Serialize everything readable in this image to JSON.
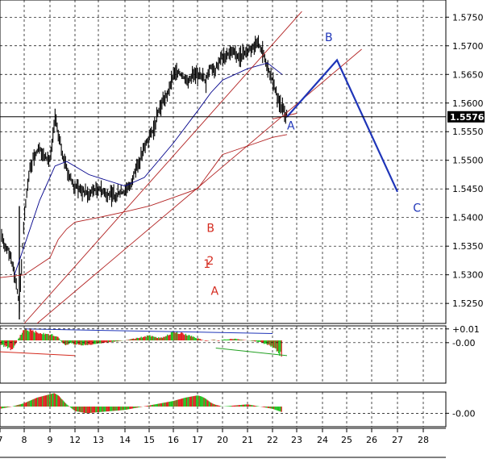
{
  "chart_data": [
    {
      "type": "line",
      "panel": "price",
      "series_kind": "bar-ohlc",
      "title": "",
      "xlabel": "",
      "ylabel": "",
      "xlim": [
        7,
        28.8
      ],
      "ylim": [
        1.5215,
        1.578
      ],
      "x_ticks": [
        "7",
        "8",
        "9",
        "12",
        "13",
        "14",
        "15",
        "16",
        "17",
        "20",
        "21",
        "22",
        "23",
        "24",
        "25",
        "26",
        "27",
        "28"
      ],
      "y_ticks": [
        "1.5750",
        "1.5700",
        "1.5650",
        "1.5600",
        "1.5550",
        "1.5500",
        "1.5450",
        "1.5400",
        "1.5350",
        "1.5300",
        "1.5250"
      ],
      "grid": true,
      "current_price": "1.5576",
      "price_series": {
        "x": [
          7.0,
          7.4,
          7.6,
          7.8,
          8.0,
          8.2,
          8.4,
          8.6,
          8.8,
          9.0,
          9.2,
          9.4,
          9.6,
          9.8,
          10.0,
          10.2,
          10.4,
          10.6,
          10.8,
          11.0,
          11.2,
          11.4,
          11.6,
          11.8,
          12.0,
          12.2,
          12.4,
          12.6,
          12.8,
          13.0,
          13.2,
          13.4,
          13.6,
          13.8,
          14.0,
          14.2,
          14.4,
          14.6,
          14.8,
          15.0,
          15.2,
          15.4,
          15.6,
          15.8,
          16.0,
          16.2,
          16.4,
          16.6,
          16.8,
          17.0,
          17.2,
          17.4,
          17.6,
          17.8,
          18.0,
          18.2,
          18.4,
          18.6,
          18.8,
          19.0,
          19.2,
          19.4,
          19.6,
          19.8,
          20.0,
          20.2,
          20.4,
          20.6,
          20.8,
          21.0,
          21.2,
          21.4,
          21.6,
          21.8,
          22.0,
          22.2,
          22.4,
          22.6
        ],
        "values": [
          1.5365,
          1.534,
          1.53,
          1.525,
          1.54,
          1.548,
          1.551,
          1.552,
          1.5505,
          1.55,
          1.552,
          1.5545,
          1.558,
          1.556,
          1.5545,
          1.553,
          1.552,
          1.5505,
          1.5495,
          1.5485,
          1.5478,
          1.547,
          1.5462,
          1.5458,
          1.5455,
          1.545,
          1.5445,
          1.544,
          1.5448,
          1.5452,
          1.5445,
          1.544,
          1.5438,
          1.5442,
          1.5445,
          1.5455,
          1.548,
          1.55,
          1.552,
          1.554,
          1.5555,
          1.5585,
          1.5605,
          1.562,
          1.565,
          1.5655,
          1.5645,
          1.564,
          1.565,
          1.5645,
          1.5655,
          1.565,
          1.5648,
          1.564,
          1.5635,
          1.565,
          1.5658,
          1.5665,
          1.566,
          1.5655,
          1.566,
          1.5668,
          1.5675,
          1.5678,
          1.568,
          1.5685,
          1.569,
          1.568,
          1.5685,
          1.569,
          1.57,
          1.5705,
          1.569,
          1.5665,
          1.564,
          1.561,
          1.559,
          1.5576
        ]
      },
      "series": [
        {
          "kind": "moving-average",
          "color": "#00008b",
          "x": [
            7.6,
            8.6,
            9.6,
            11.0,
            12.6,
            14.0,
            14.8,
            16.0,
            17.2,
            18.6,
            20.0,
            21.0,
            21.8,
            22.4
          ],
          "values": [
            1.53,
            1.543,
            1.549,
            1.5498,
            1.5475,
            1.5455,
            1.547,
            1.553,
            1.559,
            1.5618,
            1.564,
            1.566,
            1.567,
            1.565
          ]
        },
        {
          "kind": "moving-average",
          "color": "#b22222",
          "x": [
            7.0,
            8.0,
            9.0,
            10.0,
            11.0,
            12.0,
            13.0,
            14.0,
            15.0,
            16.0,
            17.0,
            18.0,
            19.0,
            20.0,
            21.0,
            22.0,
            22.6
          ],
          "values": [
            1.5295,
            1.53,
            1.533,
            1.5362,
            1.538,
            1.5392,
            1.54,
            1.541,
            1.542,
            1.5435,
            1.545,
            1.547,
            1.549,
            1.551,
            1.5525,
            1.554,
            1.5545
          ]
        },
        {
          "kind": "trendline",
          "color": "#b22222",
          "x": [
            8.0,
            23.2
          ],
          "values": [
            1.5215,
            1.576
          ]
        },
        {
          "kind": "trendline",
          "color": "#b22222",
          "x": [
            8.5,
            25.6
          ],
          "values": [
            1.5215,
            1.5694
          ]
        },
        {
          "kind": "trendline",
          "color": "#b22222",
          "x": [
            22.0,
            23.0
          ],
          "values": [
            1.5572,
            1.5582
          ]
        },
        {
          "kind": "projection",
          "color": "#1f35b8",
          "x": [
            22.6,
            24.6,
            27.0
          ],
          "values": [
            1.5576,
            1.5675,
            1.5445
          ]
        },
        {
          "kind": "last-price",
          "color": "#000000",
          "x": [
            7.0,
            28.8
          ],
          "values": [
            1.5576,
            1.5576
          ]
        }
      ],
      "annotations": [
        {
          "text": "A",
          "x": 22.6,
          "y": 1.5554,
          "color": "#1f35b8"
        },
        {
          "text": "B",
          "x": 24.1,
          "y": 1.5708,
          "color": "#1f35b8"
        },
        {
          "text": "C",
          "x": 27.6,
          "y": 1.541,
          "color": "#1f35b8"
        },
        {
          "text": "B",
          "x": 18.1,
          "y": 1.5375,
          "color": "#d42a1e"
        },
        {
          "text": "1",
          "x": 17.7,
          "y": 1.5312,
          "color": "#d42a1e"
        },
        {
          "text": "2",
          "x": 18.1,
          "y": 1.5318,
          "color": "#d42a1e"
        },
        {
          "text": "A",
          "x": 18.6,
          "y": 1.5265,
          "color": "#d42a1e"
        }
      ]
    },
    {
      "type": "bar",
      "panel": "oscillator-1",
      "y_ticks": [
        "+0.01",
        "-0.00"
      ],
      "ylim": [
        -0.0056,
        0.0019
      ],
      "colors": {
        "up": "#e02222",
        "down": "#22c322"
      },
      "x": [
        7.0,
        7.5,
        8.0,
        8.5,
        9.0,
        9.5,
        10.0,
        10.5,
        11.0,
        11.5,
        12.0,
        12.5,
        13.0,
        13.5,
        14.0,
        14.5,
        15.0,
        15.5,
        16.0,
        16.5,
        17.0,
        17.5,
        18.0,
        18.5,
        19.0,
        19.5,
        20.0,
        20.5,
        21.0,
        21.5,
        22.0,
        22.4
      ],
      "values": [
        -0.0005,
        -0.0012,
        0.0015,
        0.0011,
        0.0008,
        0.0006,
        0.0004,
        -0.0004,
        -0.0006,
        -0.0003,
        -0.0005,
        -0.0006,
        -0.0004,
        -0.0002,
        0.0,
        0.0003,
        0.0006,
        0.0003,
        0.0011,
        0.0008,
        0.0003,
        0.0001,
        -0.0001,
        0.0,
        0.0001,
        -0.0001,
        0.0001,
        0.0002,
        0.0,
        -0.0002,
        -0.0008,
        -0.002
      ],
      "divergence_lines": [
        {
          "color": "#1f35b8",
          "x": [
            8.0,
            22.0
          ],
          "values": [
            0.0015,
            0.0009
          ]
        },
        {
          "color": "#d42a1e",
          "x": [
            7.0,
            12.0
          ],
          "values": [
            -0.0015,
            -0.002
          ]
        },
        {
          "color": "#22a022",
          "x": [
            19.2,
            22.6
          ],
          "values": [
            -0.001,
            -0.002
          ]
        }
      ]
    },
    {
      "type": "bar",
      "panel": "oscillator-2",
      "y_ticks": [
        "-0.00"
      ],
      "ylim": [
        -0.0018,
        0.0013
      ],
      "colors": {
        "up": "#e02222",
        "down": "#22c322"
      },
      "x": [
        7.0,
        7.5,
        8.0,
        8.5,
        9.0,
        9.5,
        10.0,
        10.5,
        11.0,
        11.5,
        12.0,
        12.5,
        13.0,
        13.5,
        14.0,
        14.5,
        15.0,
        15.5,
        16.0,
        16.5,
        17.0,
        17.5,
        18.0,
        18.5,
        19.0,
        19.5,
        20.0,
        20.5,
        21.0,
        21.5,
        22.0,
        22.4
      ],
      "values": [
        -0.0002,
        0.0,
        0.0003,
        0.0008,
        0.0011,
        0.0012,
        0.001,
        0.0006,
        0.0002,
        -0.0001,
        -0.0004,
        -0.0006,
        -0.0005,
        -0.0004,
        -0.0003,
        -0.0001,
        0.0001,
        0.0003,
        0.0005,
        0.0008,
        0.001,
        0.0009,
        0.0007,
        0.0004,
        0.0002,
        0.0001,
        0.0,
        0.0001,
        0.0002,
        0.0,
        -0.0002,
        -0.0005
      ]
    }
  ]
}
